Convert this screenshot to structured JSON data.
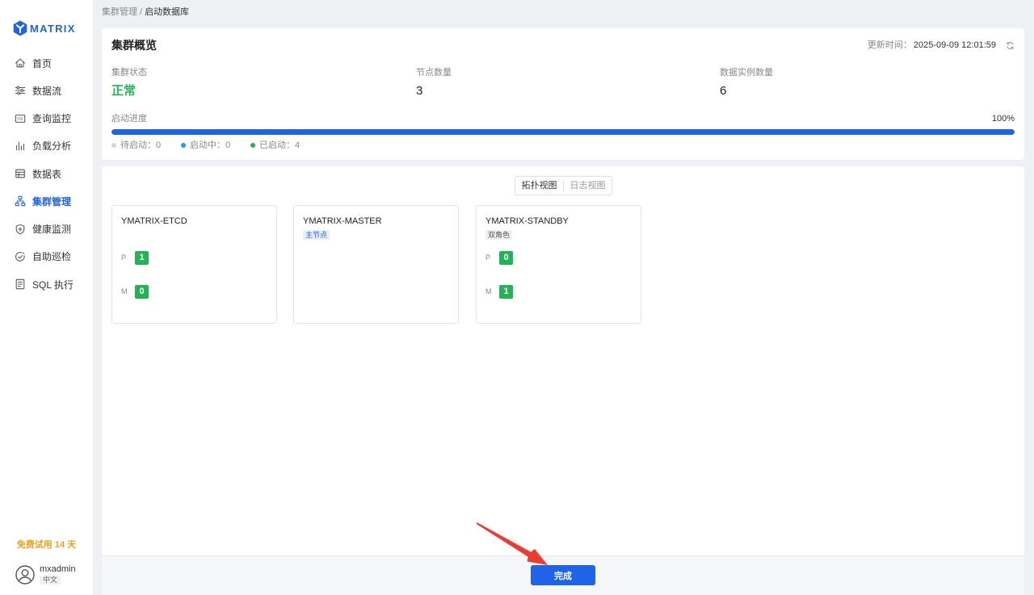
{
  "app": {
    "logo_text": "MATRIX",
    "logo_icon": "ymatrix-hexagon-logo-icon"
  },
  "sidebar": {
    "items": [
      {
        "label": "首页",
        "icon": "home-icon",
        "active": false
      },
      {
        "label": "数据流",
        "icon": "data-flow-icon",
        "active": false
      },
      {
        "label": "查询监控",
        "icon": "sql-monitor-icon",
        "active": false
      },
      {
        "label": "负载分析",
        "icon": "bar-chart-icon",
        "active": false
      },
      {
        "label": "数据表",
        "icon": "table-icon",
        "active": false
      },
      {
        "label": "集群管理",
        "icon": "cluster-icon",
        "active": true
      },
      {
        "label": "健康监测",
        "icon": "shield-plus-icon",
        "active": false
      },
      {
        "label": "自助巡检",
        "icon": "inspection-icon",
        "active": false
      },
      {
        "label": "SQL 执行",
        "icon": "sql-document-icon",
        "active": false
      }
    ],
    "trial_text": "免费试用 14 天",
    "user": {
      "name": "mxadmin",
      "language": "中文",
      "avatar_icon": "user-avatar-icon"
    }
  },
  "breadcrumb": {
    "parent": "集群管理",
    "separator": "/",
    "current": "启动数据库"
  },
  "overview": {
    "title": "集群概览",
    "updated_label": "更新时间：",
    "updated_time": "2025-09-09 12:01:59",
    "refresh_icon": "refresh-icon",
    "stats": [
      {
        "label": "集群状态",
        "value": "正常"
      },
      {
        "label": "节点数量",
        "value": "3"
      },
      {
        "label": "数据实例数量",
        "value": "6"
      }
    ],
    "progress": {
      "label": "启动进度",
      "percent_text": "100%",
      "percent": 100
    },
    "legend": [
      {
        "label": "待启动：",
        "count": "0",
        "color": "#d3d6dc"
      },
      {
        "label": "启动中：",
        "count": "0",
        "color": "#1aa0e8"
      },
      {
        "label": "已启动：",
        "count": "4",
        "color": "#22b356"
      }
    ]
  },
  "topology": {
    "tabs": [
      {
        "label": "拓扑视图",
        "selected": true
      },
      {
        "label": "日志视图",
        "selected": false
      }
    ],
    "nodes": [
      {
        "name": "YMATRIX-ETCD",
        "roles": [
          {
            "role": "P",
            "count": "1"
          },
          {
            "role": "M",
            "count": "0"
          }
        ]
      },
      {
        "name": "YMATRIX-MASTER",
        "tag": "主节点",
        "roles": []
      },
      {
        "name": "YMATRIX-STANDBY",
        "tag": "双角色",
        "roles": [
          {
            "role": "P",
            "count": "0"
          },
          {
            "role": "M",
            "count": "1"
          }
        ]
      }
    ]
  },
  "footer": {
    "done_label": "完成"
  },
  "colors": {
    "primary": "#1f64e8",
    "success": "#22b356",
    "warning": "#f5a01a",
    "annotation": "#ee3b33"
  }
}
